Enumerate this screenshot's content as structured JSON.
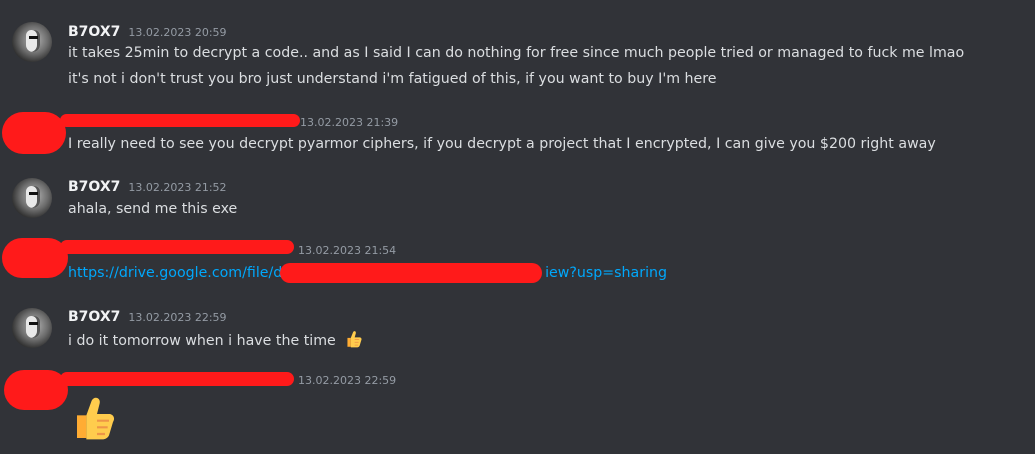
{
  "messages": [
    {
      "author": "B7OX7",
      "time": "13.02.2023 20:59",
      "lines": [
        "it takes 25min to decrypt a code.. and as I said I can do nothing for free since much people tried or managed to fuck me lmao",
        "it's not i don't trust you bro just understand i'm fatigued of this, if you want to buy I'm here"
      ]
    },
    {
      "author": "",
      "time": "13.02.2023 21:39",
      "lines": [
        "I really need to see you decrypt pyarmor ciphers, if you decrypt a project that I encrypted, I can give you $200 right away"
      ]
    },
    {
      "author": "B7OX7",
      "time": "13.02.2023 21:52",
      "lines": [
        "ahala, send me this exe"
      ]
    },
    {
      "author": "",
      "time": "13.02.2023 21:54",
      "link_start": "https://drive.google.com/file/d/",
      "link_end": "iew?usp=sharing"
    },
    {
      "author": "B7OX7",
      "time": "13.02.2023 22:59",
      "lines": [
        "i do it tomorrow when i have the time"
      ],
      "emoji": "thumbs-up"
    },
    {
      "author": "",
      "time": "13.02.2023 22:59",
      "emoji": "thumbs-up"
    }
  ],
  "colors": {
    "background": "#313338",
    "link": "#00a8fc",
    "redaction": "#ff1a1a",
    "timestamp": "#949ba4"
  }
}
